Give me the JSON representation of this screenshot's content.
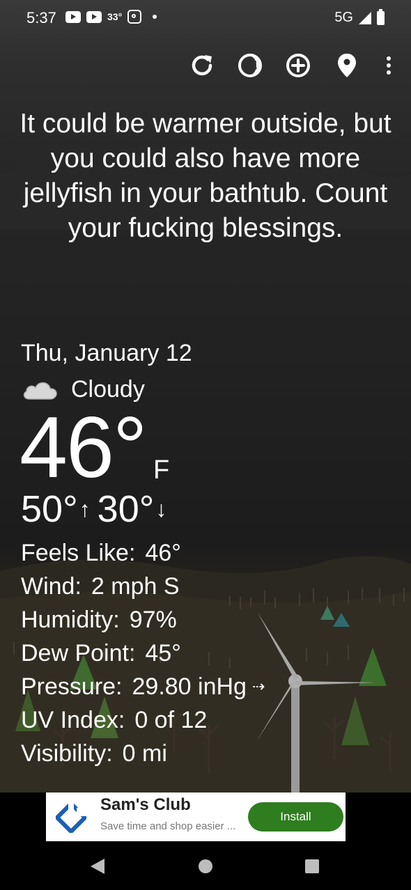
{
  "status": {
    "time": "5:37",
    "temp": "33°",
    "network": "5G"
  },
  "toolbar": {
    "icons": [
      "refresh-icon",
      "theme-icon",
      "add-location-icon",
      "location-pin-icon",
      "more-vert-icon"
    ]
  },
  "quote": "It could be warmer outside, but you could also have more jellyfish in your bathtub. Count your fucking blessings.",
  "weather": {
    "date": "Thu, January 12",
    "condition": "Cloudy",
    "condition_icon": "cloud-icon",
    "temperature": "46°",
    "unit": "F",
    "high": "50°",
    "low": "30°"
  },
  "details": {
    "feels_like_label": "Feels Like:",
    "feels_like_value": "46°",
    "wind_label": "Wind:",
    "wind_value": "2 mph S",
    "humidity_label": "Humidity:",
    "humidity_value": "97%",
    "dew_point_label": "Dew Point:",
    "dew_point_value": "45°",
    "pressure_label": "Pressure:",
    "pressure_value": "29.80 inHg",
    "uv_label": "UV Index:",
    "uv_value": "0 of 12",
    "visibility_label": "Visibility:",
    "visibility_value": "0 mi"
  },
  "ad": {
    "title": "Sam's Club",
    "subtitle": "Save time and shop easier ...",
    "button": "Install",
    "accent": "#2e7d1f"
  },
  "colors": {
    "sky_top": "#3a3a3a",
    "ground": "#2c291f",
    "install_green": "#2e7d1f"
  }
}
